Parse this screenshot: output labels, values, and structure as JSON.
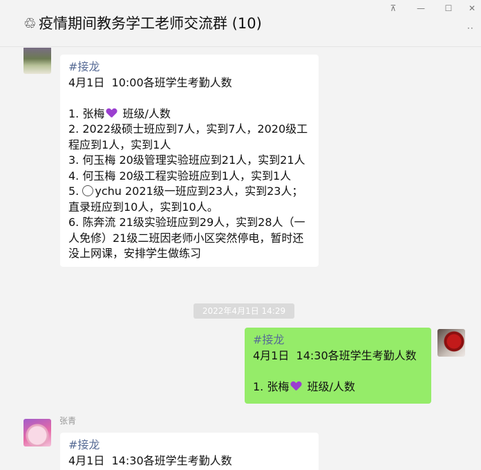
{
  "window": {
    "title": "疫情期间教务学工老师交流群 (10)",
    "title_icon": "♲",
    "buttons": [
      "⊼",
      "—",
      "☐",
      "✕"
    ],
    "more": "··"
  },
  "messages": [
    {
      "tag": "#接龙",
      "lines": [
        "4月1日  10:00各班学生考勤人数",
        "",
        "1. 张梅 [heart]  班级/人数",
        "2. 2022级硕士班应到7人，实到7人，2020级工程应到1人，实到1人",
        "3. 何玉梅 20级管理实验班应到21人，实到21人",
        "4. 何玉梅 20级工程实验班应到1人，实到1人",
        "5. [emoji]ychu 2021级一班应到23人，实到23人；直录班应到10人，实到10人。",
        "6. 陈奔流 21级实验班应到29人，实到28人（一人免修）21级二班因老师小区突然停电，暂时还没上网课，安排学生做练习"
      ]
    },
    {
      "tag": "#接龙",
      "lines": [
        "4月1日  14:30各班学生考勤人数",
        "",
        "1. 张梅 [heart]  班级/人数"
      ]
    },
    {
      "sender": "张青",
      "tag": "#接龙",
      "lines": [
        "4月1日  14:30各班学生考勤人数"
      ]
    }
  ],
  "timestamp": "2022年4月1日 14:29",
  "colors": {
    "tag": "#576b95",
    "self_bubble": "#95ec69",
    "other_bubble": "#ffffff",
    "background": "#f3f3f3"
  }
}
